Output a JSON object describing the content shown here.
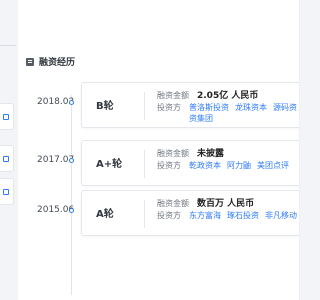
{
  "section": {
    "title": "融资经历"
  },
  "funding_rounds": [
    {
      "date": "2018.02",
      "round": "B轮",
      "amount_label": "融资金额",
      "amount": "2.05亿 人民币",
      "investors_label": "投资方",
      "investors": [
        "普洛斯投资",
        "龙珠资本",
        "源码资"
      ],
      "investors_line2": "资集团"
    },
    {
      "date": "2017.07",
      "round": "A+轮",
      "amount_label": "融资金额",
      "amount": "未披露",
      "investors_label": "投资方",
      "investors": [
        "乾政资本",
        "阿力鼬",
        "美团点评"
      ],
      "investors_line2": ""
    },
    {
      "date": "2015.06",
      "round": "A轮",
      "amount_label": "融资金额",
      "amount": "数百万 人民币",
      "investors_label": "投资方",
      "investors": [
        "东方富海",
        "琢石投资",
        "非凡移动"
      ],
      "investors_line2": ""
    }
  ],
  "colors": {
    "link": "#2f7bf5",
    "text": "#333840",
    "muted": "#6f7680",
    "border": "#e5e7ec"
  },
  "icons": {
    "section": "document-icon",
    "timeline_dot": "circle-dot-icon"
  }
}
